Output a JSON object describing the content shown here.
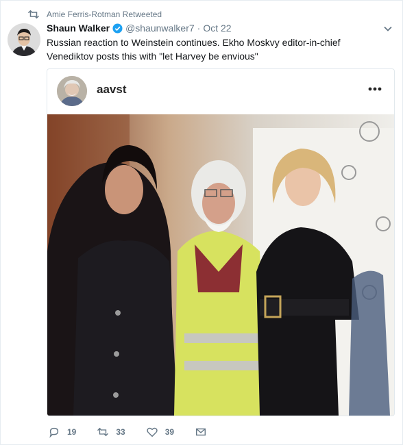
{
  "retweet_banner": {
    "text": "Amie Ferris-Rotman Retweeted",
    "icon": "retweet-icon"
  },
  "tweet": {
    "author_name": "Shaun Walker",
    "handle": "@shaunwalker7",
    "separator": "·",
    "date": "Oct 22",
    "text": "Russian reaction to Weinstein continues. Ekho Moskvy editor-in-chief Venediktov posts this with \"let Harvey be envious\"",
    "verified": true
  },
  "embed": {
    "username": "aavst",
    "more_icon": "more-dots-icon"
  },
  "actions": {
    "replies": "19",
    "retweets": "33",
    "likes": "39"
  },
  "colors": {
    "text": "#14171a",
    "muted": "#657786",
    "verified": "#1da1f2",
    "border": "#e1e8ed"
  }
}
